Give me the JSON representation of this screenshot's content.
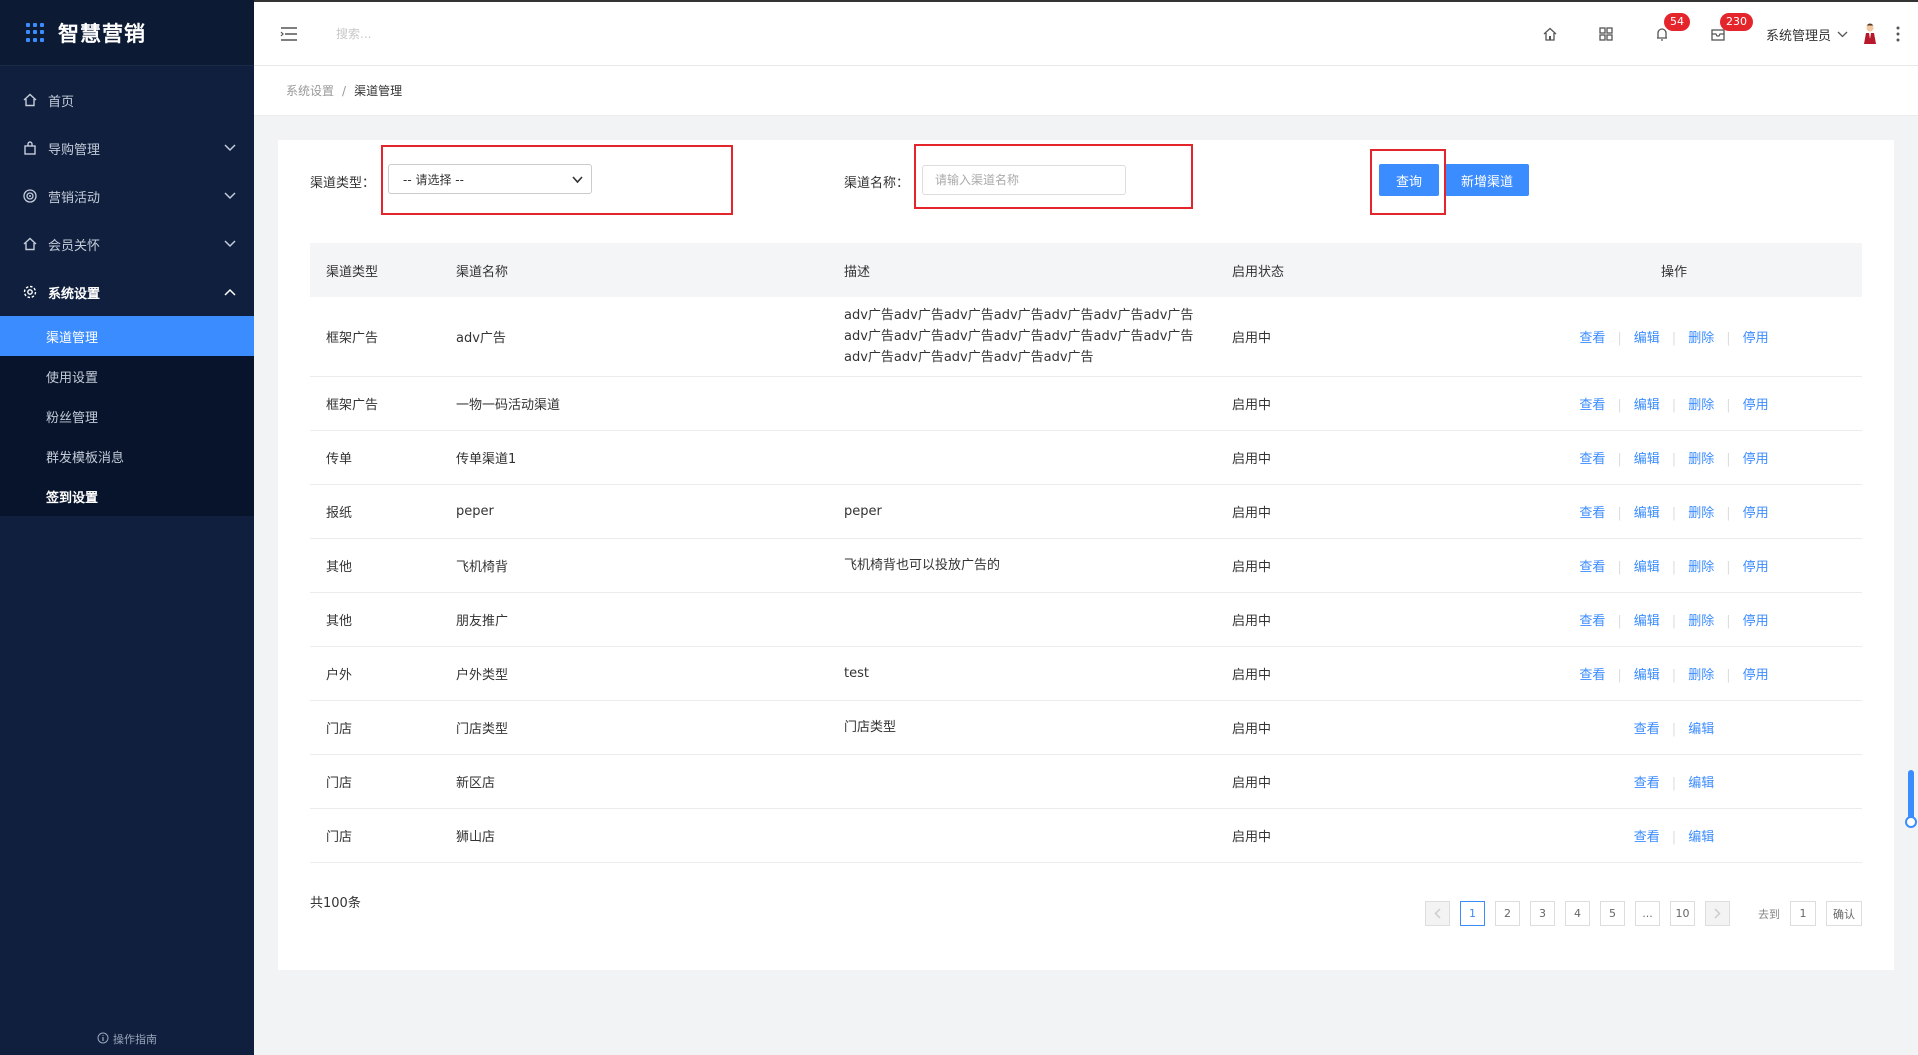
{
  "app": {
    "title": "智慧营销"
  },
  "sidebar": {
    "items": [
      {
        "label": "首页",
        "icon": "home-icon"
      },
      {
        "label": "导购管理",
        "icon": "bag-icon"
      },
      {
        "label": "营销活动",
        "icon": "target-icon"
      },
      {
        "label": "会员关怀",
        "icon": "home-icon"
      },
      {
        "label": "系统设置",
        "icon": "gear-icon"
      }
    ],
    "sub_items": [
      {
        "label": "渠道管理"
      },
      {
        "label": "使用设置"
      },
      {
        "label": "粉丝管理"
      },
      {
        "label": "群发模板消息"
      },
      {
        "label": "签到设置"
      }
    ],
    "guide": "操作指南"
  },
  "header": {
    "search_placeholder": "搜索...",
    "notifications_count": "54",
    "messages_count": "230",
    "user_name": "系统管理员"
  },
  "breadcrumb": {
    "parent": "系统设置",
    "separator": "/",
    "current": "渠道管理"
  },
  "filters": {
    "type_label": "渠道类型：",
    "type_value": "-- 请选择 --",
    "name_label": "渠道名称：",
    "name_placeholder": "请输入渠道名称",
    "query_button": "查询",
    "add_button": "新增渠道"
  },
  "table": {
    "headers": {
      "type": "渠道类型",
      "name": "渠道名称",
      "desc": "描述",
      "status": "启用状态",
      "ops": "操作"
    },
    "op_labels": {
      "view": "查看",
      "edit": "编辑",
      "delete": "删除",
      "disable": "停用"
    },
    "rows": [
      {
        "type": "框架广告",
        "name": "adv广告",
        "desc": "adv广告adv广告adv广告adv广告adv广告adv广告adv广告adv广告adv广告adv广告adv广告adv广告adv广告adv广告adv广告adv广告adv广告adv广告adv广告",
        "status": "启用中",
        "full_ops": true
      },
      {
        "type": "框架广告",
        "name": "一物一码活动渠道",
        "desc": "",
        "status": "启用中",
        "full_ops": true
      },
      {
        "type": "传单",
        "name": "传单渠道1",
        "desc": "",
        "status": "启用中",
        "full_ops": true
      },
      {
        "type": "报纸",
        "name": "peper",
        "desc": "peper",
        "status": "启用中",
        "full_ops": true
      },
      {
        "type": "其他",
        "name": "飞机椅背",
        "desc": "飞机椅背也可以投放广告的",
        "status": "启用中",
        "full_ops": true
      },
      {
        "type": "其他",
        "name": "朋友推广",
        "desc": "",
        "status": "启用中",
        "full_ops": true
      },
      {
        "type": "户外",
        "name": "户外类型",
        "desc": "test",
        "status": "启用中",
        "full_ops": true
      },
      {
        "type": "门店",
        "name": "门店类型",
        "desc": "门店类型",
        "status": "启用中",
        "full_ops": false
      },
      {
        "type": "门店",
        "name": "新区店",
        "desc": "",
        "status": "启用中",
        "full_ops": false
      },
      {
        "type": "门店",
        "name": "狮山店",
        "desc": "",
        "status": "启用中",
        "full_ops": false
      }
    ]
  },
  "pagination": {
    "total": "共100条",
    "pages": [
      "1",
      "2",
      "3",
      "4",
      "5",
      "...",
      "10"
    ],
    "current": "1",
    "goto_label": "去到",
    "goto_value": "1",
    "confirm": "确认"
  },
  "colors": {
    "accent": "#3b8cff",
    "sidebar_bg": "#0f1f3d",
    "badge": "#e4262c",
    "highlight": "#e4262c"
  }
}
